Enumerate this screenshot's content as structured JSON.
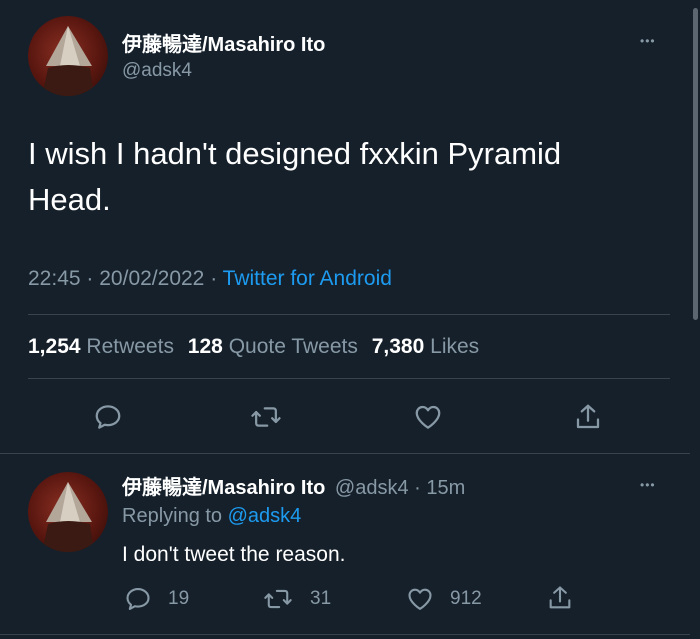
{
  "main_tweet": {
    "display_name": "伊藤暢達/Masahiro Ito",
    "handle": "@adsk4",
    "text_line1": "I wish I hadn't designed fxxkin Pyramid",
    "text_line2": "Head.",
    "time": "22:45",
    "date": "20/02/2022",
    "separator": "·",
    "source": "Twitter for Android",
    "retweets_count": "1,254",
    "retweets_label": "Retweets",
    "quotes_count": "128",
    "quotes_label": "Quote Tweets",
    "likes_count": "7,380",
    "likes_label": "Likes"
  },
  "reply": {
    "display_name": "伊藤暢達/Masahiro Ito",
    "handle": "@adsk4",
    "time_ago": "· 15m",
    "replying_prefix": "Replying to",
    "replying_handle": "@adsk4",
    "text": "I don't tweet the reason.",
    "reply_count": "19",
    "retweet_count": "31",
    "like_count": "912"
  },
  "more_glyph": "•••",
  "colors": {
    "background": "#15202b",
    "accent": "#1d9bf0",
    "muted": "#8899a6",
    "divider": "#38444d"
  }
}
